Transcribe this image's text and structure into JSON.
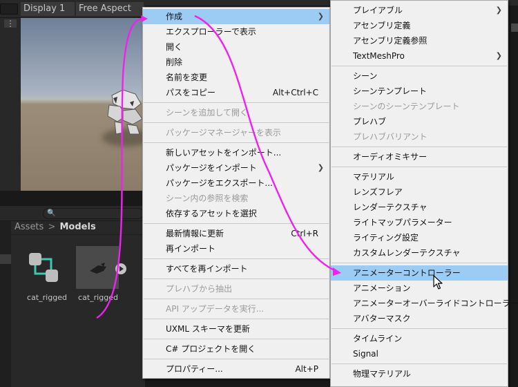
{
  "game_view": {
    "display_label": "Display 1",
    "aspect_label": "Free Aspect",
    "kebab": "⋮"
  },
  "project": {
    "breadcrumb": {
      "root": "Assets",
      "separator": ">",
      "current": "Models"
    },
    "assets": [
      {
        "label": "cat_rigged",
        "kind": "animator-controller"
      },
      {
        "label": "cat_rigged",
        "kind": "model"
      }
    ]
  },
  "context_menu": {
    "items": [
      {
        "label": "作成",
        "submenu": true,
        "highlighted": true
      },
      {
        "label": "エクスプローラーで表示"
      },
      {
        "label": "開く"
      },
      {
        "label": "削除"
      },
      {
        "label": "名前を変更"
      },
      {
        "label": "パスをコピー",
        "shortcut": "Alt+Ctrl+C"
      },
      {
        "label": "シーンを追加して開く",
        "disabled": true
      },
      {
        "label": "パッケージマネージャーを表示",
        "disabled": true
      },
      {
        "label": "新しいアセットをインポート..."
      },
      {
        "label": "パッケージをインポート",
        "submenu": true
      },
      {
        "label": "パッケージをエクスポート..."
      },
      {
        "label": "シーン内の参照を検索",
        "disabled": true
      },
      {
        "label": "依存するアセットを選択"
      },
      {
        "label": "最新情報に更新",
        "shortcut": "Ctrl+R"
      },
      {
        "label": "再インポート"
      },
      {
        "label": "すべてを再インポート"
      },
      {
        "label": "プレハブから抽出",
        "disabled": true
      },
      {
        "label": "API アップデータを実行...",
        "disabled": true
      },
      {
        "label": "UXML スキーマを更新"
      },
      {
        "label": "C# プロジェクトを開く"
      },
      {
        "label": "プロパティー...",
        "shortcut": "Alt+P"
      }
    ]
  },
  "create_submenu": {
    "items": [
      {
        "label": "プレイアブル",
        "submenu": true
      },
      {
        "label": "アセンブリ定義"
      },
      {
        "label": "アセンブリ定義参照"
      },
      {
        "label": "TextMeshPro",
        "submenu": true
      },
      {
        "label": "シーン"
      },
      {
        "label": "シーンテンプレート"
      },
      {
        "label": "シーンのシーンテンプレート",
        "disabled": true
      },
      {
        "label": "プレハブ"
      },
      {
        "label": "プレハブバリアント",
        "disabled": true
      },
      {
        "label": "オーディオミキサー"
      },
      {
        "label": "マテリアル"
      },
      {
        "label": "レンズフレア"
      },
      {
        "label": "レンダーテクスチャ"
      },
      {
        "label": "ライトマップパラメーター"
      },
      {
        "label": "ライティング設定"
      },
      {
        "label": "カスタムレンダーテクスチャ"
      },
      {
        "label": "アニメーターコントローラー",
        "highlighted": true
      },
      {
        "label": "アニメーション"
      },
      {
        "label": "アニメーターオーバーライドコントローラー"
      },
      {
        "label": "アバターマスク"
      },
      {
        "label": "タイムライン"
      },
      {
        "label": "Signal"
      },
      {
        "label": "物理マテリアル"
      }
    ]
  },
  "colors": {
    "menu_bg": "#f0f0f0",
    "menu_highlight": "#9ccbf4",
    "annotation_arrow": "#ee22ee",
    "editor_dark": "#282828"
  }
}
